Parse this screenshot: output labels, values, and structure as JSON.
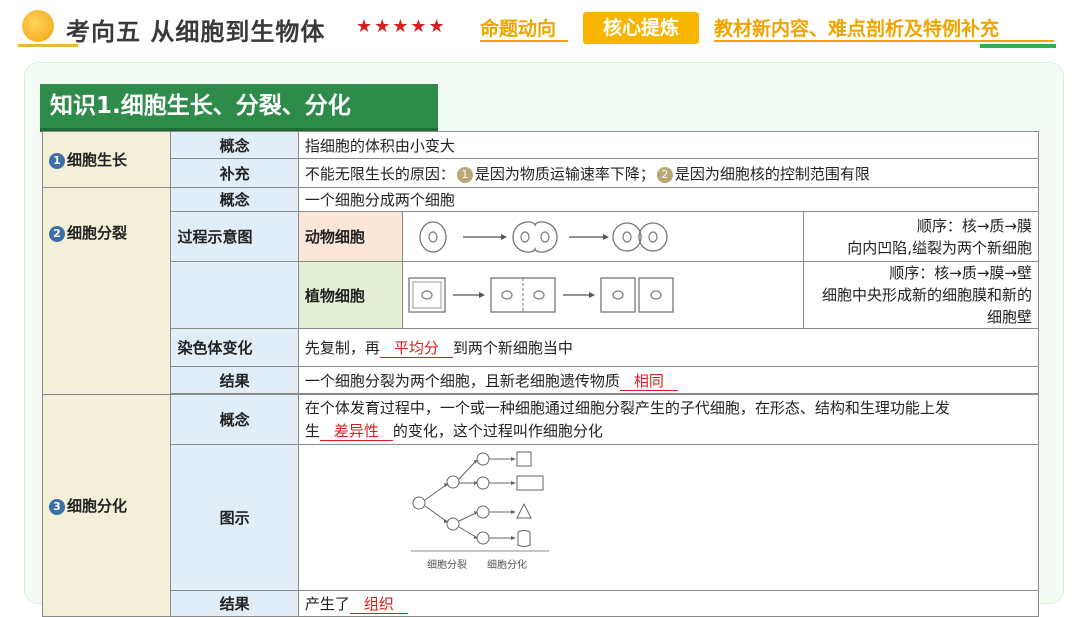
{
  "header": {
    "title": "考向五  从细胞到生物体",
    "stars": "★★★★★",
    "tabs": [
      "命题动向",
      "核心提炼",
      "教材新内容、难点剖析及特例补充"
    ]
  },
  "section": {
    "title": "知识1.细胞生长、分裂、分化"
  },
  "growth": {
    "label": "细胞生长",
    "num": "1",
    "concept_label": "概念",
    "concept": "指细胞的体积由小变大",
    "supplement_label": "补充",
    "supplement_prefix": "不能无限生长的原因：",
    "supp1_num": "1",
    "supp1": "是因为物质运输速率下降；",
    "supp2_num": "2",
    "supp2": "是因为细胞核的控制范围有限"
  },
  "division": {
    "label": "细胞分裂",
    "num": "2",
    "concept_label": "概念",
    "concept": "一个细胞分成两个细胞",
    "process_label": "过程示意图",
    "animal_label": "动物细胞",
    "animal_note1": "顺序：核→质→膜",
    "animal_note2": "向内凹陷,缢裂为两个新细胞",
    "plant_label": "植物细胞",
    "plant_note1": "顺序：核→质→膜→壁",
    "plant_note2": "细胞中央形成新的细胞膜和新的细胞壁",
    "chromo_label": "染色体变化",
    "chromo_prefix": "先复制，再",
    "chromo_blank": "平均分",
    "chromo_suffix": "到两个新细胞当中",
    "result_label": "结果",
    "result_prefix": "一个细胞分裂为两个细胞，且新老细胞遗传物质",
    "result_blank": "相同"
  },
  "differentiation": {
    "label": "细胞分化",
    "num": "3",
    "concept_label": "概念",
    "concept_line1": "在个体发育过程中，一个或一种细胞通过细胞分裂产生的子代细胞，在形态、结构和生理功能上发",
    "concept_prefix2": "生",
    "concept_blank": "差异性",
    "concept_suffix2": "的变化，这个过程叫作细胞分化",
    "diagram_label": "图示",
    "diagram_caption1": "细胞分裂",
    "diagram_caption2": "细胞分化",
    "result_label": "结果",
    "result_prefix": "产生了",
    "result_blank": "组织"
  },
  "colors": {
    "green": "#2e8b4a",
    "orange": "#f8b500",
    "red": "#d81e1e",
    "cat_bg": "#f3efd8",
    "sub_bg": "#e1eef8"
  }
}
